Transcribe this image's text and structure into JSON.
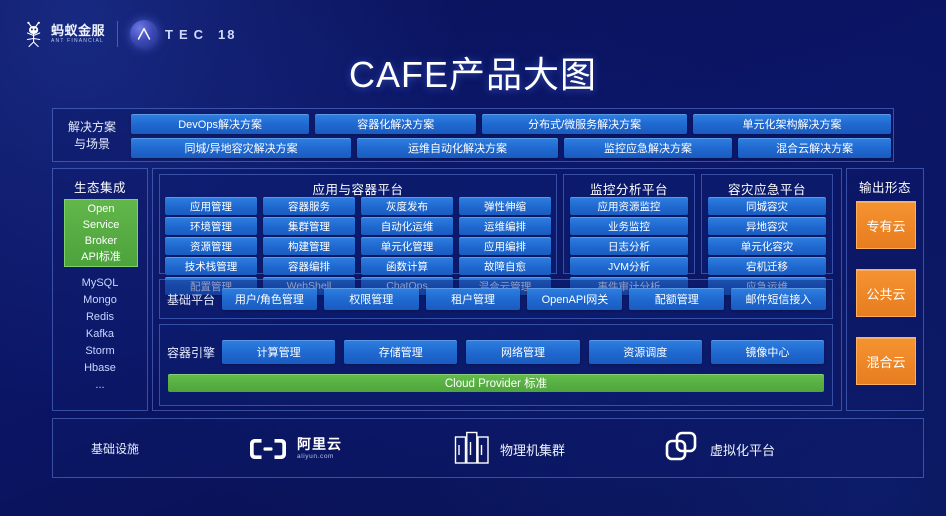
{
  "brand": {
    "ant_cn": "蚂蚁金服",
    "ant_en": "ANT FINANCIAL",
    "atec_word": "TEC",
    "atec_num": "18"
  },
  "title": "CAFE产品大图",
  "solutions": {
    "label_line1": "解决方案",
    "label_line2": "与场景",
    "row1": [
      "DevOps解决方案",
      "容器化解决方案",
      "分布式/微服务解决方案",
      "单元化架构解决方案"
    ],
    "row2": [
      "同城/异地容灾解决方案",
      "运维自动化解决方案",
      "监控应急解决方案",
      "混合云解决方案"
    ]
  },
  "ecosystem": {
    "title": "生态集成",
    "standard": [
      "Open",
      "Service",
      "Broker",
      "API标准"
    ],
    "items": [
      "MySQL",
      "Mongo",
      "Redis",
      "Kafka",
      "Storm",
      "Hbase",
      "..."
    ]
  },
  "app_platform": {
    "title": "应用与容器平台",
    "columns": [
      [
        "应用管理",
        "环境管理",
        "资源管理",
        "技术栈管理",
        "配置管理"
      ],
      [
        "容器服务",
        "集群管理",
        "构建管理",
        "容器编排",
        "WebShell"
      ],
      [
        "灰度发布",
        "自动化运维",
        "单元化管理",
        "函数计算",
        "ChatOps"
      ],
      [
        "弹性伸缩",
        "运维编排",
        "应用编排",
        "故障自愈",
        "混合云管理"
      ]
    ]
  },
  "monitor_platform": {
    "title": "监控分析平台",
    "items": [
      "应用资源监控",
      "业务监控",
      "日志分析",
      "JVM分析",
      "事件审计分析"
    ]
  },
  "dr_platform": {
    "title": "容灾应急平台",
    "items": [
      "同城容灾",
      "异地容灾",
      "单元化容灾",
      "宕机迁移",
      "应急运维"
    ]
  },
  "base_platform": {
    "label": "基础平台",
    "items": [
      "用户/角色管理",
      "权限管理",
      "租户管理",
      "OpenAPI网关",
      "配额管理",
      "邮件短信接入"
    ]
  },
  "container_engine": {
    "label": "容器引擎",
    "items": [
      "计算管理",
      "存储管理",
      "网络管理",
      "资源调度",
      "镜像中心"
    ],
    "cloud_provider": "Cloud Provider 标准"
  },
  "output": {
    "title": "输出形态",
    "items": [
      "专有云",
      "公共云",
      "混合云"
    ]
  },
  "infrastructure": {
    "label": "基础设施",
    "aliyun_cn": "阿里云",
    "aliyun_en": "aliyun.com",
    "physical": "物理机集群",
    "virtual": "虚拟化平台"
  },
  "colors": {
    "background": "#0b1560",
    "chip_blue": "#1f68cf",
    "green": "#4ea53c",
    "orange": "#e77d20",
    "panel_border": "#78a0ff"
  }
}
